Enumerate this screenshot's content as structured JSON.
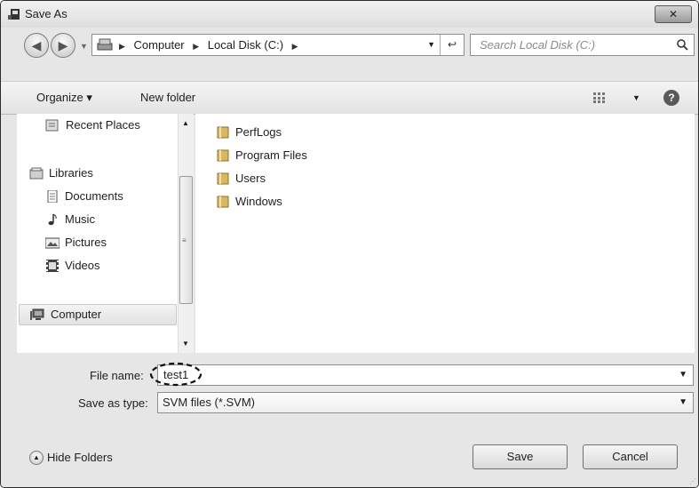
{
  "window": {
    "title": "Save As",
    "close_label": "✕"
  },
  "nav": {
    "address_crumbs": [
      "Computer",
      "Local Disk (C:)"
    ],
    "search_placeholder": "Search Local Disk (C:)"
  },
  "toolbar": {
    "organize_label": "Organize ▾",
    "new_folder_label": "New folder"
  },
  "sidebar": {
    "items": [
      {
        "label": "Recent Places",
        "icon": "recent-places-icon"
      },
      {
        "label": "Libraries",
        "icon": "libraries-icon"
      },
      {
        "label": "Documents",
        "icon": "documents-icon"
      },
      {
        "label": "Music",
        "icon": "music-icon"
      },
      {
        "label": "Pictures",
        "icon": "pictures-icon"
      },
      {
        "label": "Videos",
        "icon": "videos-icon"
      },
      {
        "label": "Computer",
        "icon": "computer-icon",
        "selected": true
      }
    ]
  },
  "files": [
    {
      "name": "PerfLogs",
      "icon": "folder-icon"
    },
    {
      "name": "Program Files",
      "icon": "folder-icon"
    },
    {
      "name": "Users",
      "icon": "folder-icon"
    },
    {
      "name": "Windows",
      "icon": "folder-icon"
    }
  ],
  "form": {
    "file_name_label": "File name:",
    "file_name_value": "test1",
    "save_type_label": "Save as type:",
    "save_type_value": "SVM files (*.SVM)"
  },
  "footer": {
    "hide_folders_label": "Hide Folders",
    "save_label": "Save",
    "cancel_label": "Cancel"
  },
  "colors": {
    "frame": "#e6e6e6",
    "pane": "#ffffff",
    "folder": "#d9b860"
  }
}
